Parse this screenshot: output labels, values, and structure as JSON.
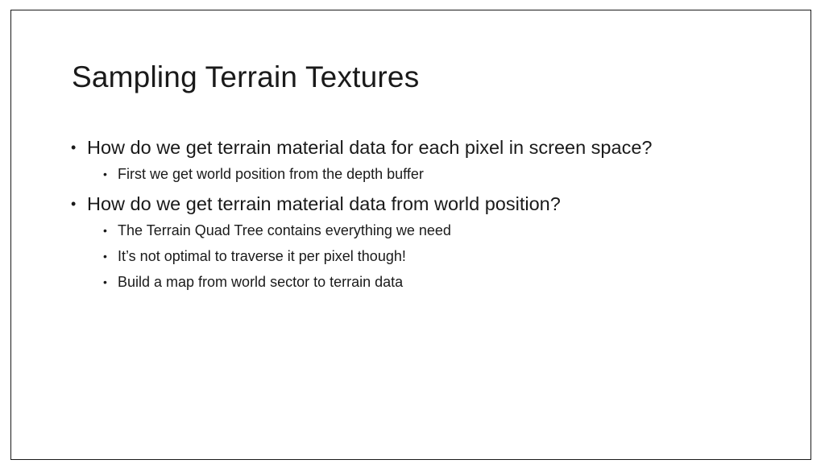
{
  "slide": {
    "title": "Sampling Terrain Textures",
    "bullets": [
      {
        "text": "How do we get terrain material data for each pixel in screen space?",
        "sub": [
          "First we get world position from the depth buffer"
        ]
      },
      {
        "text": "How do we get terrain material data from world position?",
        "sub": [
          "The Terrain Quad Tree contains everything we need",
          "It’s not optimal to traverse it per pixel though!",
          "Build a map from world sector to terrain data"
        ]
      }
    ],
    "bullet_glyph": "•"
  }
}
